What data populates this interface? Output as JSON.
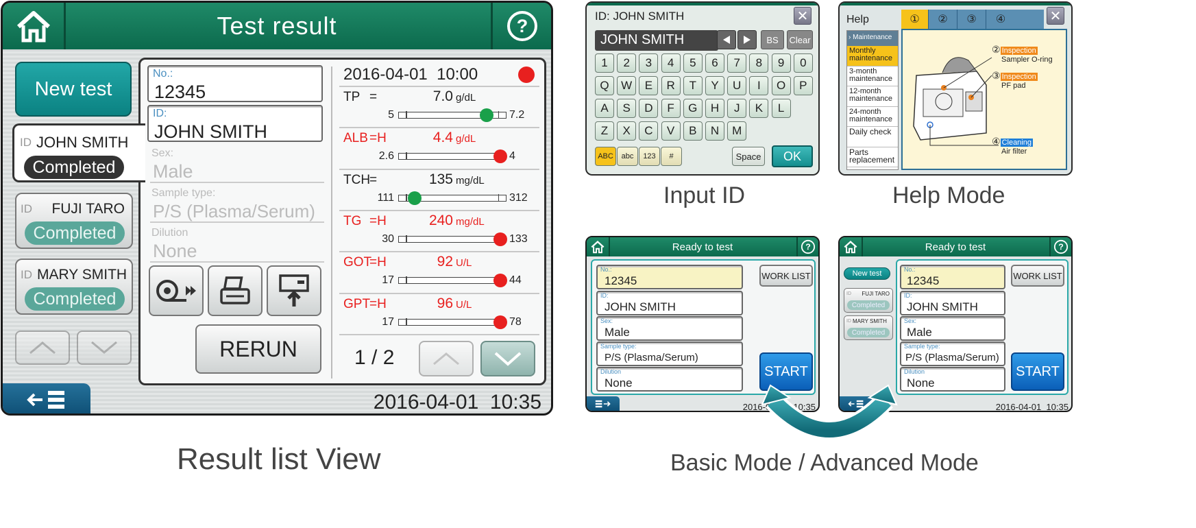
{
  "main": {
    "title": "Test result",
    "new_test": "New test",
    "patients": [
      {
        "id_label": "ID",
        "name": "JOHN SMITH",
        "status": "Completed"
      },
      {
        "id_label": "ID",
        "name": "FUJI TARO",
        "status": "Completed"
      },
      {
        "id_label": "ID",
        "name": "MARY SMITH",
        "status": "Completed"
      }
    ],
    "fields": {
      "no_label": "No.:",
      "no_value": "12345",
      "id_label": "ID:",
      "id_value": "JOHN SMITH",
      "sex_label": "Sex:",
      "sex_value": "Male",
      "sample_label": "Sample type:",
      "sample_value": "P/S (Plasma/Serum)",
      "dilution_label": "Dilution",
      "dilution_value": "None"
    },
    "rerun": "RERUN",
    "result_datetime": "2016-04-01  10:00",
    "results": [
      {
        "name": "TP",
        "flag": "=",
        "value": "7.0",
        "unit": "g/dL",
        "low": "5",
        "high": "7.2",
        "position": 0.82,
        "color": "#1aa04a",
        "abnormal": false
      },
      {
        "name": "ALB",
        "flag": "=H",
        "value": "4.4",
        "unit": "g/dL",
        "low": "2.6",
        "high": "4",
        "position": 0.95,
        "color": "#e8201f",
        "abnormal": true
      },
      {
        "name": "TCH",
        "flag": "=",
        "value": "135",
        "unit": "mg/dL",
        "low": "111",
        "high": "312",
        "position": 0.15,
        "color": "#1aa04a",
        "abnormal": false
      },
      {
        "name": "TG",
        "flag": "=H",
        "value": "240",
        "unit": "mg/dL",
        "low": "30",
        "high": "133",
        "position": 0.95,
        "color": "#e8201f",
        "abnormal": true
      },
      {
        "name": "GOT",
        "flag": "=H",
        "value": "92",
        "unit": "U/L",
        "low": "17",
        "high": "44",
        "position": 0.95,
        "color": "#e8201f",
        "abnormal": true
      },
      {
        "name": "GPT",
        "flag": "=H",
        "value": "96",
        "unit": "U/L",
        "low": "17",
        "high": "78",
        "position": 0.95,
        "color": "#e8201f",
        "abnormal": true
      }
    ],
    "page": "1 / 2",
    "clock": "2016-04-01  10:35"
  },
  "input_id": {
    "title": "ID: JOHN SMITH",
    "value": "JOHN SMITH",
    "bs": "BS",
    "clear": "Clear",
    "row1": [
      "1",
      "2",
      "3",
      "4",
      "5",
      "6",
      "7",
      "8",
      "9",
      "0"
    ],
    "row2": [
      "Q",
      "W",
      "E",
      "R",
      "T",
      "Y",
      "U",
      "I",
      "O",
      "P"
    ],
    "row3": [
      "A",
      "S",
      "D",
      "F",
      "G",
      "H",
      "J",
      "K",
      "L"
    ],
    "row4": [
      "Z",
      "X",
      "C",
      "V",
      "B",
      "N",
      "M"
    ],
    "modes": [
      "ABC",
      "abc",
      "123",
      "#"
    ],
    "space": "Space",
    "ok": "OK"
  },
  "help": {
    "title": "Help",
    "tabs": [
      "①",
      "②",
      "③",
      "④"
    ],
    "menu_header": "Maintenance",
    "menu": [
      "Monthly maintenance",
      "3-month maintenance",
      "12-month maintenance",
      "24-month maintenance",
      "Daily check",
      "Parts replacement"
    ],
    "callouts": [
      {
        "num": "②",
        "tag": "Inspection",
        "text": "Sampler O-ring"
      },
      {
        "num": "③",
        "tag": "Inspection",
        "text": "PF pad"
      },
      {
        "num": "④",
        "tag": "Cleaning",
        "text": "Air filter"
      }
    ]
  },
  "basic": {
    "title": "Ready to test",
    "no_label": "No.:",
    "no_value": "12345",
    "id_label": "ID:",
    "id_value": "JOHN SMITH",
    "sex_label": "Sex:",
    "sex_value": "Male",
    "sample_label": "Sample type:",
    "sample_value": "P/S (Plasma/Serum)",
    "dilution_label": "Dilution",
    "dilution_value": "None",
    "worklist": "WORK LIST",
    "start": "START",
    "clock": "2016-04-01  10:35"
  },
  "advanced": {
    "title": "Ready to test",
    "new_test": "New test",
    "patients": [
      {
        "id_label": "ID",
        "name": "FUJI TARO",
        "status": "Completed"
      },
      {
        "id_label": "ID",
        "name": "MARY SMITH",
        "status": "Completed"
      }
    ],
    "no_label": "No.:",
    "no_value": "12345",
    "id_label": "ID:",
    "id_value": "JOHN SMITH",
    "sex_label": "Sex:",
    "sex_value": "Male",
    "sample_label": "Sample type:",
    "sample_value": "P/S (Plasma/Serum)",
    "dilution_label": "Dilution",
    "dilution_value": "None",
    "worklist": "WORK LIST",
    "start": "START",
    "clock": "2016-04-01  10:35"
  },
  "captions": {
    "result_list": "Result list View",
    "input_id": "Input ID",
    "help": "Help Mode",
    "modes": "Basic Mode / Advanced Mode"
  },
  "colors": {
    "header_green": "#0c6a4d",
    "teal": "#0b8282",
    "alert_red": "#e8201f",
    "normal_green": "#1aa04a"
  }
}
